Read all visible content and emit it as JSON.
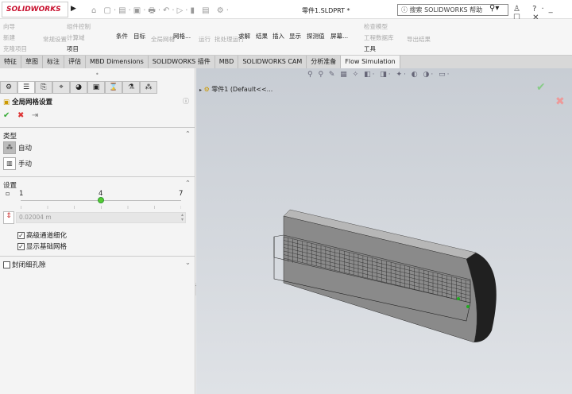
{
  "app": {
    "logo": "SOLIDWORKS",
    "doc_title": "零件1.SLDPRT *",
    "search_placeholder": "搜索 SOLIDWORKS 帮助"
  },
  "ribbon": {
    "items": [
      "向导",
      "新建",
      "克隆项目",
      "常规设置",
      "组件控制",
      "计算域",
      "项目",
      "条件",
      "目标",
      "全局网格",
      "网格...",
      "运行",
      "批处理运行",
      "求解",
      "结果",
      "插入",
      "显示",
      "探测值",
      "屏幕...",
      "检查模型",
      "工程数据库",
      "工具",
      "导出结果"
    ]
  },
  "tabs": [
    "特征",
    "草图",
    "标注",
    "评估",
    "MBD Dimensions",
    "SOLIDWORKS 插件",
    "MBD",
    "SOLIDWORKS CAM",
    "分析准备",
    "Flow Simulation"
  ],
  "panel": {
    "title": "全局网格设置",
    "type_label": "类型",
    "auto": "自动",
    "manual": "手动",
    "settings_label": "设置",
    "slider_min": "1",
    "slider_value": "4",
    "slider_max": "7",
    "slider_fraction": 0.5,
    "min_gap": "0.02004 m",
    "adv_channel": "高级通道细化",
    "show_basic": "显示基础网格",
    "close_gaps": "封闭细孔隙"
  },
  "viewport": {
    "tree_item": "零件1  (Default<<..."
  }
}
